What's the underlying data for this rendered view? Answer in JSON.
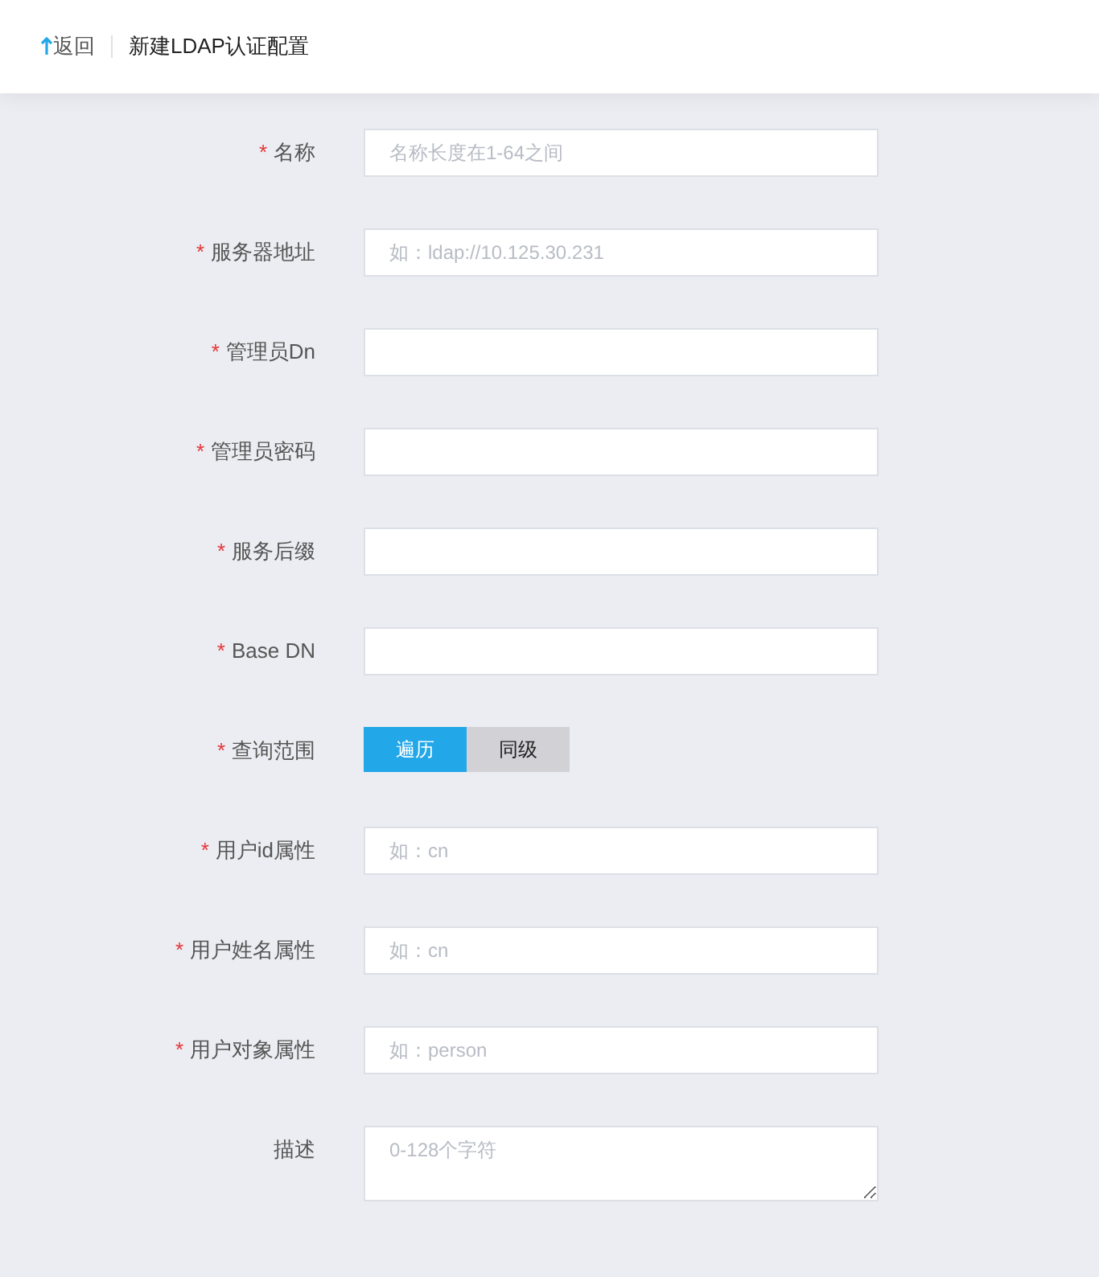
{
  "header": {
    "back_label": "返回",
    "title": "新建LDAP认证配置"
  },
  "fields": [
    {
      "kind": "input",
      "required_mark": "*",
      "label": "名称",
      "placeholder": "名称长度在1-64之间"
    },
    {
      "kind": "input",
      "required_mark": "*",
      "label": "服务器地址",
      "placeholder": "如：ldap://10.125.30.231"
    },
    {
      "kind": "input",
      "required_mark": "*",
      "label": "管理员Dn"
    },
    {
      "kind": "input",
      "required_mark": "*",
      "label": "管理员密码"
    },
    {
      "kind": "input",
      "required_mark": "*",
      "label": "服务后缀"
    },
    {
      "kind": "input",
      "required_mark": "*",
      "label": "Base DN"
    },
    {
      "kind": "segmented",
      "required_mark": "*",
      "label": "查询范围",
      "options": [
        {
          "label": "遍历",
          "selected": true
        },
        {
          "label": "同级",
          "selected": false
        }
      ]
    },
    {
      "kind": "input",
      "required_mark": "*",
      "label": "用户id属性",
      "placeholder": "如：cn"
    },
    {
      "kind": "input",
      "required_mark": "*",
      "label": "用户姓名属性",
      "placeholder": "如：cn"
    },
    {
      "kind": "input",
      "required_mark": "*",
      "label": "用户对象属性",
      "placeholder": "如：person"
    },
    {
      "kind": "textarea",
      "label": "描述",
      "placeholder": "0-128个字符"
    }
  ]
}
